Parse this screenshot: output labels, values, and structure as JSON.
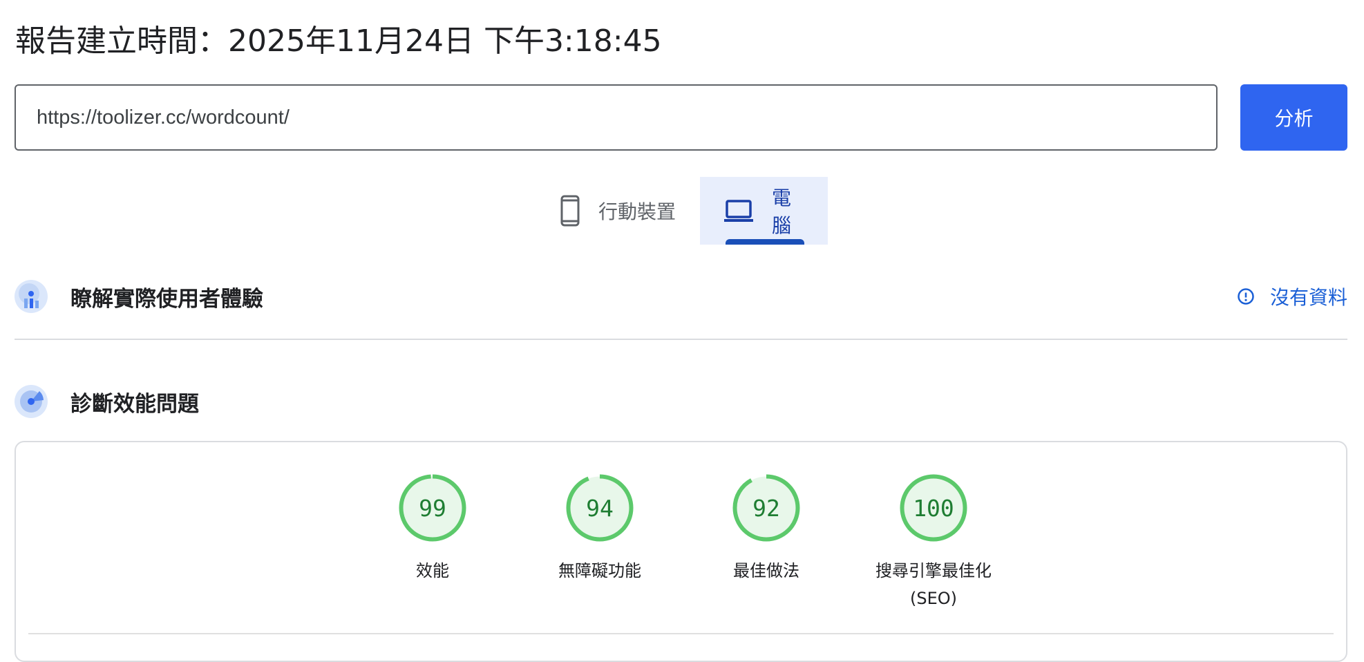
{
  "report_time": "報告建立時間：2025年11月24日 下午3:18:45",
  "url_input": {
    "value": "https://toolizer.cc/wordcount/"
  },
  "analyze_label": "分析",
  "tabs": [
    {
      "label": "行動裝置",
      "icon": "smartphone-icon",
      "selected": false
    },
    {
      "label": "電腦",
      "icon": "laptop-icon",
      "selected": true
    }
  ],
  "field_data": {
    "title": "瞭解實際使用者體驗",
    "status": "沒有資料",
    "icon": "info-icon"
  },
  "lab_data": {
    "title": "診斷效能問題"
  },
  "scores": [
    {
      "value": 99,
      "label": "效能",
      "label2": ""
    },
    {
      "value": 94,
      "label": "無障礙功能",
      "label2": ""
    },
    {
      "value": 92,
      "label": "最佳做法",
      "label2": ""
    },
    {
      "value": 100,
      "label": "搜尋引擎最佳化",
      "label2": "(SEO)"
    }
  ],
  "colors": {
    "accent": "#2f65f0",
    "pass_green": "#5cc96b",
    "pass_fill": "#e8f7ea",
    "pass_text": "#1e7d32"
  }
}
